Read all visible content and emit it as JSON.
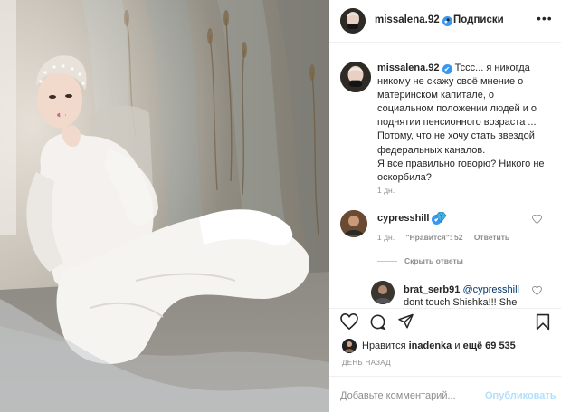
{
  "header": {
    "username": "missalena.92",
    "verified_mark": "✔",
    "separator": "•",
    "follow_state": "Подписки",
    "more_icon": "more-horizontal-icon"
  },
  "caption": {
    "username": "missalena.92",
    "verified_mark": "✔",
    "lines": [
      "Тссс... я никогда",
      "никому не скажу своё мнение о",
      "материнском капитале, о",
      "социальном положении людей и о",
      "поднятии пенсионного возраста ...",
      "Потому, что не хочу стать звездой",
      "федеральных каналов.",
      "Я все правильно говорю? Никого не",
      "оскорбила?"
    ],
    "time": "1 дн."
  },
  "comment": {
    "username": "cypresshill",
    "verified_mark": "✔",
    "emoji_icon": "gem-icon",
    "time": "1 дн.",
    "likes_label": "\"Нравится\": 52",
    "reply_label": "Ответить"
  },
  "hide_replies": "Скрыть ответы",
  "reply": {
    "username": "brat_serb91",
    "mention": "@cypresshill",
    "line2": "dont touch Shishka!!! She"
  },
  "likes": {
    "prefix": "Нравится",
    "user": "inadenka",
    "connector": "и",
    "rest": "ещё 69 535"
  },
  "date": "ДЕНЬ НАЗАД",
  "comment_box": {
    "placeholder": "Добавьте комментарий...",
    "publish": "Опубликовать"
  },
  "colors": {
    "link_blue": "#3897f0",
    "publish_disabled": "#b2dffc",
    "muted": "#8e8e8e",
    "text": "#262626"
  }
}
